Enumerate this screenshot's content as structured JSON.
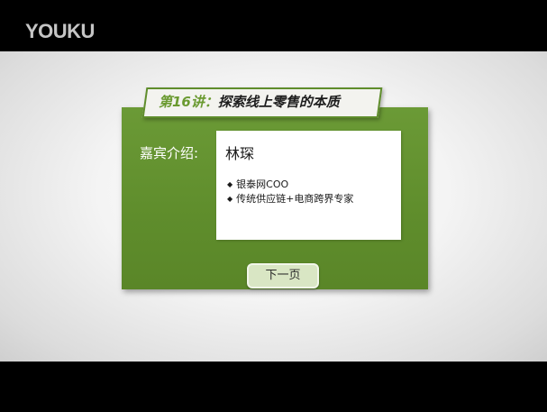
{
  "header": {
    "logo_text": "YOUKU"
  },
  "slide": {
    "title_prefix": "第16讲",
    "title_separator": "：",
    "title_main": "探索线上零售的本质",
    "guest_label": "嘉宾介绍:",
    "guest_name": "林琛",
    "bullets": [
      "银泰网COO",
      "传统供应链+电商跨界专家"
    ],
    "next_button_label": "下一页"
  },
  "colors": {
    "panel_green": "#5f8d2c",
    "title_accent": "#6a9a30",
    "button_bg": "#d9e6c4"
  }
}
